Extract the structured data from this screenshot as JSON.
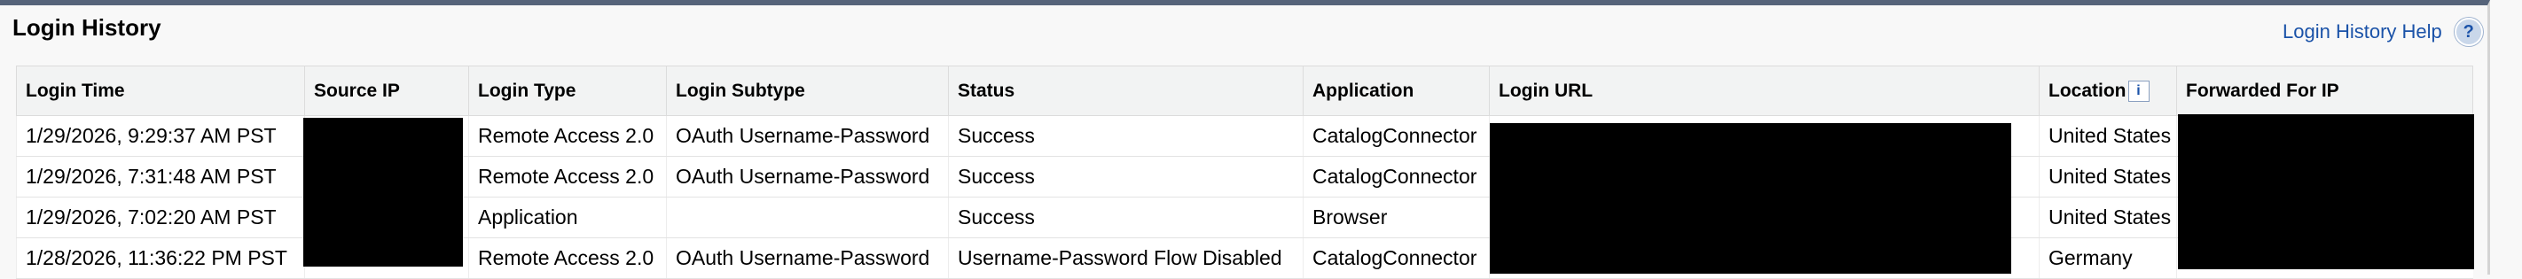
{
  "header": {
    "title": "Login History",
    "help_link": "Login History Help",
    "help_icon": "?"
  },
  "table": {
    "columns": [
      "Login Time",
      "Source IP",
      "Login Type",
      "Login Subtype",
      "Status",
      "Application",
      "Login URL",
      "Location",
      "Forwarded For IP"
    ],
    "location_info_icon": "i",
    "rows": [
      {
        "login_time": "1/29/2026, 9:29:37 AM PST",
        "login_type": "Remote Access 2.0",
        "login_subtype": "OAuth Username-Password",
        "status": "Success",
        "application": "CatalogConnector",
        "location": "United States"
      },
      {
        "login_time": "1/29/2026, 7:31:48 AM PST",
        "login_type": "Remote Access 2.0",
        "login_subtype": "OAuth Username-Password",
        "status": "Success",
        "application": "CatalogConnector",
        "location": "United States"
      },
      {
        "login_time": "1/29/2026, 7:02:20 AM PST",
        "login_type": "Application",
        "login_subtype": "",
        "status": "Success",
        "application": "Browser",
        "location": "United States"
      },
      {
        "login_time": "1/28/2026, 11:36:22 PM PST",
        "login_type": "Remote Access 2.0",
        "login_subtype": "OAuth Username-Password",
        "status": "Username-Password Flow Disabled",
        "application": "CatalogConnector",
        "location": "Germany"
      }
    ]
  }
}
